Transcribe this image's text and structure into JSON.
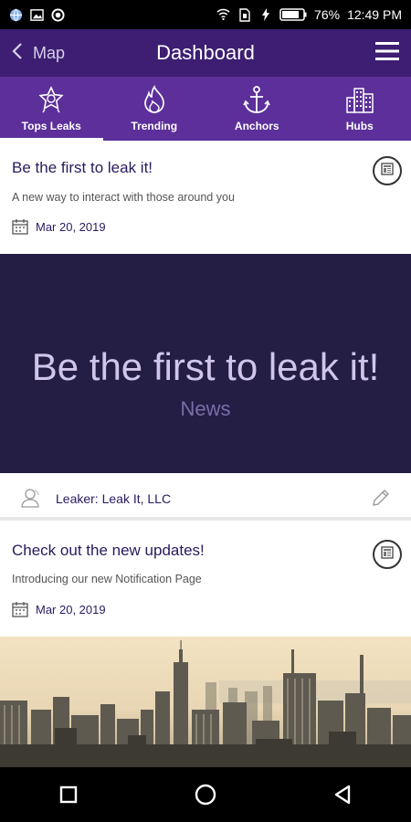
{
  "status_bar": {
    "battery": "76%",
    "time": "12:49 PM"
  },
  "header": {
    "back_label": "Map",
    "title": "Dashboard"
  },
  "tabs": [
    {
      "label": "Tops Leaks",
      "icon": "star-badge-icon",
      "active": true
    },
    {
      "label": "Trending",
      "icon": "flame-icon",
      "active": false
    },
    {
      "label": "Anchors",
      "icon": "anchor-icon",
      "active": false
    },
    {
      "label": "Hubs",
      "icon": "city-buildings-icon",
      "active": false
    }
  ],
  "posts": [
    {
      "title": "Be the first to leak it!",
      "subtitle": "A new way to interact with those around you",
      "date": "Mar 20, 2019",
      "banner_title": "Be the first to leak it!",
      "banner_category": "News",
      "leaker": "Leaker: Leak It, LLC"
    },
    {
      "title": "Check out the new updates!",
      "subtitle": "Introducing our new Notification Page",
      "date": "Mar 20, 2019"
    }
  ],
  "colors": {
    "appbar": "#3d1e72",
    "tabbar": "#5c2f9a",
    "banner": "#241d44",
    "text_primary": "#2a1a5e"
  }
}
